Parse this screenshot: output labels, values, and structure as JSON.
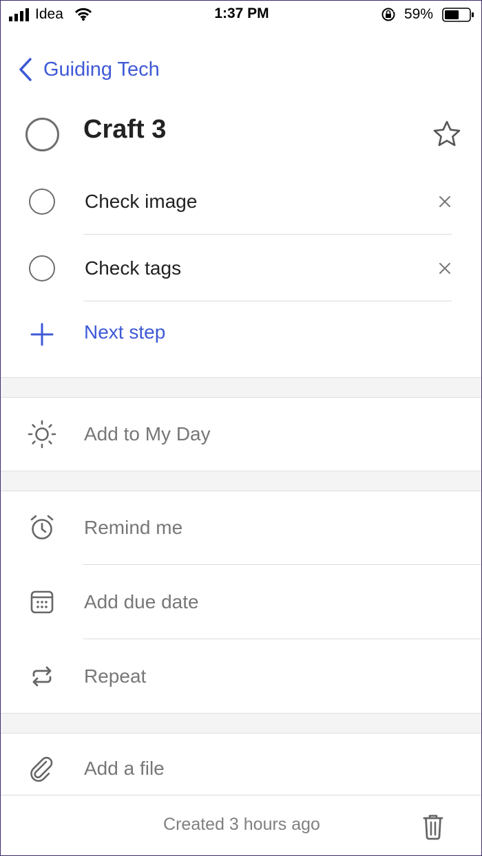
{
  "status_bar": {
    "carrier": "Idea",
    "time": "1:37 PM",
    "battery_percent": "59%",
    "battery_level": 0.59
  },
  "nav": {
    "back_label": "Guiding Tech"
  },
  "task": {
    "title": "Craft 3",
    "starred": false,
    "steps": [
      {
        "label": "Check image"
      },
      {
        "label": "Check tags"
      }
    ],
    "next_step_label": "Next step"
  },
  "options": {
    "my_day": "Add to My Day",
    "remind": "Remind me",
    "due_date": "Add due date",
    "repeat": "Repeat",
    "file": "Add a file"
  },
  "footer": {
    "created": "Created 3 hours ago"
  },
  "colors": {
    "accent": "#3e59d6",
    "muted_text": "#777777",
    "icon_gray": "#666666"
  }
}
